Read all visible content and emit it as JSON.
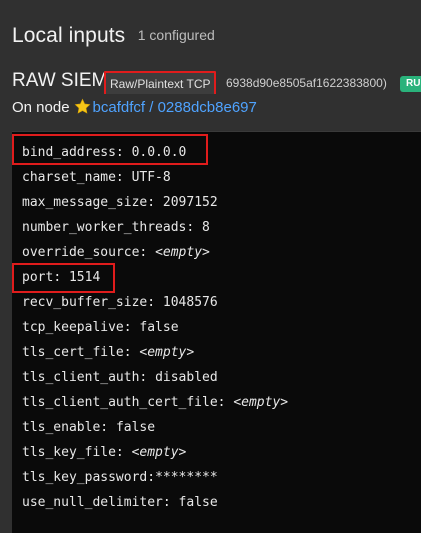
{
  "header": {
    "title": "Local inputs",
    "count_label": "1 configured"
  },
  "input": {
    "name": "RAW SIEM",
    "type": "Raw/Plaintext TCP",
    "id": "6938d90e8505af1622383800)",
    "status": "RUNNING"
  },
  "node": {
    "label": "On node",
    "icon": "star-icon",
    "link": "bcafdfcf / 0288dcb8e697"
  },
  "colors": {
    "highlight": "#e01c1c",
    "link": "#4fa3ff",
    "status": "#2ab27b"
  },
  "config": [
    {
      "key": "bind_address",
      "sep": ": ",
      "value": "0.0.0.0",
      "empty": false
    },
    {
      "key": "charset_name",
      "sep": ": ",
      "value": "UTF-8",
      "empty": false
    },
    {
      "key": "max_message_size",
      "sep": ": ",
      "value": "2097152",
      "empty": false
    },
    {
      "key": "number_worker_threads",
      "sep": ": ",
      "value": "8",
      "empty": false
    },
    {
      "key": "override_source",
      "sep": ": ",
      "value": "<empty>",
      "empty": true
    },
    {
      "key": "port",
      "sep": ": ",
      "value": "1514",
      "empty": false
    },
    {
      "key": "recv_buffer_size",
      "sep": ": ",
      "value": "1048576",
      "empty": false
    },
    {
      "key": "tcp_keepalive",
      "sep": ": ",
      "value": "false",
      "empty": false
    },
    {
      "key": "tls_cert_file",
      "sep": ": ",
      "value": "<empty>",
      "empty": true
    },
    {
      "key": "tls_client_auth",
      "sep": ": ",
      "value": "disabled",
      "empty": false
    },
    {
      "key": "tls_client_auth_cert_file",
      "sep": ": ",
      "value": "<empty>",
      "empty": true
    },
    {
      "key": "tls_enable",
      "sep": ": ",
      "value": "false",
      "empty": false
    },
    {
      "key": "tls_key_file",
      "sep": ": ",
      "value": "<empty>",
      "empty": true
    },
    {
      "key": "tls_key_password",
      "sep": ":",
      "value": "********",
      "empty": false
    },
    {
      "key": "use_null_delimiter",
      "sep": ": ",
      "value": "false",
      "empty": false
    }
  ]
}
